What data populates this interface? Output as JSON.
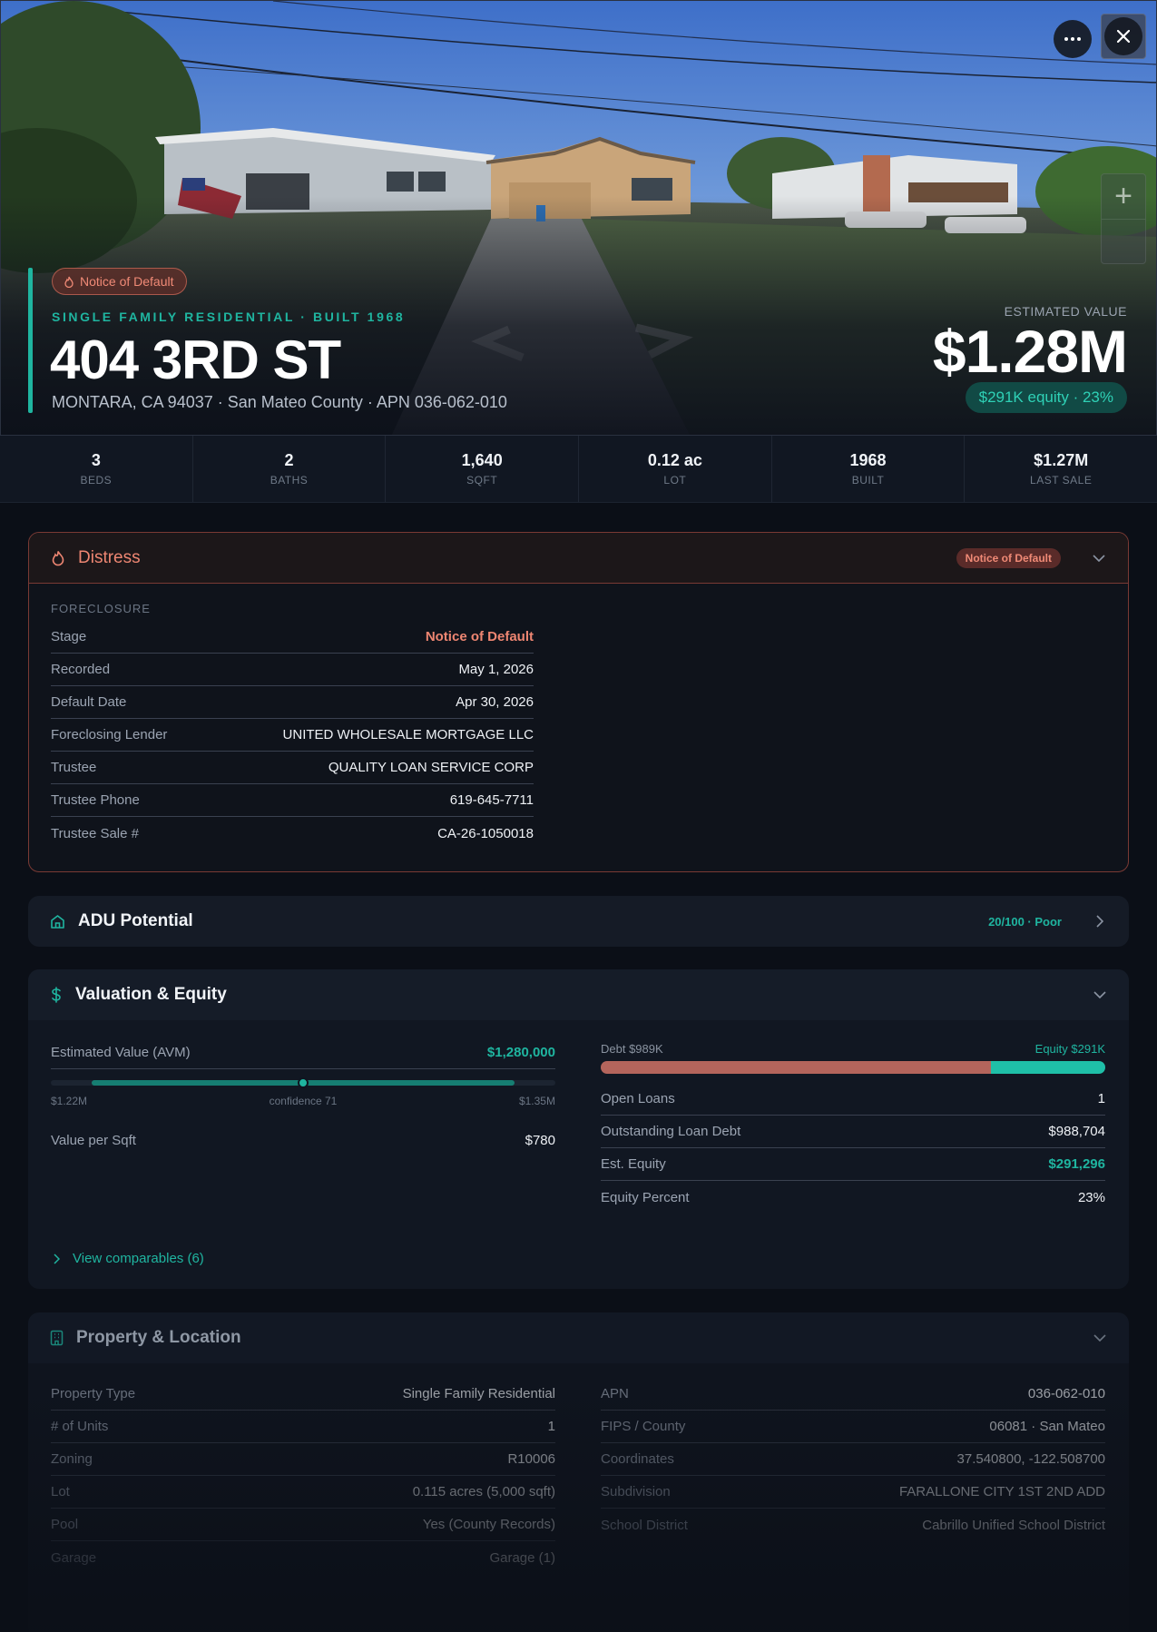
{
  "hero": {
    "status_badge": "Notice of Default",
    "kicker": "SINGLE FAMILY RESIDENTIAL · BUILT 1968",
    "address": "404 3RD ST",
    "subline": "MONTARA, CA 94037 · San Mateo County · APN 036-062-010",
    "estimated_label": "ESTIMATED VALUE",
    "estimated_value": "$1.28M",
    "equity_pill": "$291K equity · 23%",
    "zoom_in_label": "+"
  },
  "stats": [
    {
      "value": "3",
      "label": "BEDS"
    },
    {
      "value": "2",
      "label": "BATHS"
    },
    {
      "value": "1,640",
      "label": "SQFT"
    },
    {
      "value": "0.12 ac",
      "label": "LOT"
    },
    {
      "value": "1968",
      "label": "BUILT"
    },
    {
      "value": "$1.27M",
      "label": "LAST SALE"
    }
  ],
  "distress": {
    "title": "Distress",
    "badge": "Notice of Default",
    "section": "FORECLOSURE",
    "rows": [
      {
        "k": "Stage",
        "v": "Notice of Default"
      },
      {
        "k": "Recorded",
        "v": "May 1, 2026"
      },
      {
        "k": "Default Date",
        "v": "Apr 30, 2026"
      },
      {
        "k": "Foreclosing Lender",
        "v": "UNITED WHOLESALE MORTGAGE LLC"
      },
      {
        "k": "Trustee",
        "v": "QUALITY LOAN SERVICE CORP"
      },
      {
        "k": "Trustee Phone",
        "v": "619-645-7711"
      },
      {
        "k": "Trustee Sale #",
        "v": "CA-26-1050018"
      }
    ]
  },
  "adu": {
    "title": "ADU Potential",
    "score": "20/100 · Poor"
  },
  "valuation": {
    "title": "Valuation & Equity",
    "avm_label": "Estimated Value (AVM)",
    "avm_value": "$1,280,000",
    "range_low": "$1.22M",
    "range_mid": "confidence 71",
    "range_high": "$1.35M",
    "range_position": 0.5,
    "vps_label": "Value per Sqft",
    "vps_value": "$780",
    "debt_label": "Debt $989K",
    "equity_label": "Equity $291K",
    "debt_fraction": 0.773,
    "rows": [
      {
        "k": "Open Loans",
        "v": "1"
      },
      {
        "k": "Outstanding Loan Debt",
        "v": "$988,704"
      },
      {
        "k": "Est. Equity",
        "v": "$291,296"
      },
      {
        "k": "Equity Percent",
        "v": "23%"
      }
    ],
    "comparables_link": "View comparables (6)"
  },
  "property": {
    "title": "Property & Location",
    "left_rows": [
      {
        "k": "Property Type",
        "v": "Single Family Residential"
      },
      {
        "k": "# of Units",
        "v": "1"
      },
      {
        "k": "Zoning",
        "v": "R10006"
      },
      {
        "k": "Lot",
        "v": "0.115 acres (5,000 sqft)"
      },
      {
        "k": "Pool",
        "v": "Yes (County Records)"
      },
      {
        "k": "Garage",
        "v": "Garage (1)"
      }
    ],
    "right_rows": [
      {
        "k": "APN",
        "v": "036-062-010"
      },
      {
        "k": "FIPS / County",
        "v": "06081 · San Mateo"
      },
      {
        "k": "Coordinates",
        "v": "37.540800, -122.508700"
      },
      {
        "k": "Subdivision",
        "v": "FARALLONE CITY 1ST 2ND ADD"
      },
      {
        "k": "School District",
        "v": "Cabrillo Unified School District"
      }
    ]
  },
  "colors": {
    "accent_teal": "#1fb5a0",
    "distress_red": "#ee8672",
    "debt_bar": "#b4655c",
    "equity_bar": "#1fbfa8"
  }
}
